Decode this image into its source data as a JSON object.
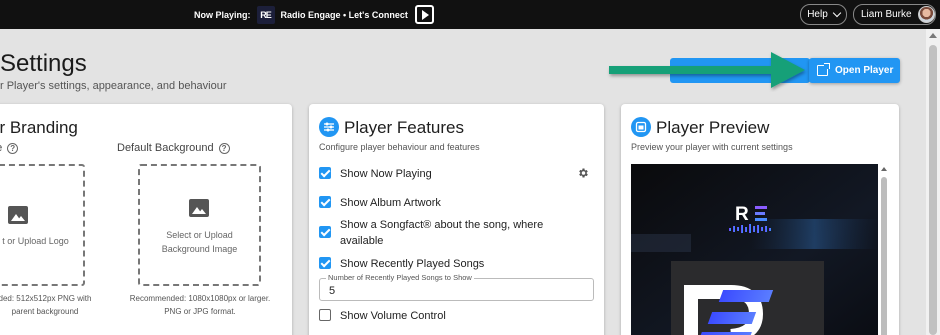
{
  "topbar": {
    "now_playing_label": "Now Playing:",
    "station_logo_text": "RE",
    "station_text": "Radio Engage • Let's Connect",
    "help_label": "Help",
    "user_name": "Liam Burke"
  },
  "header": {
    "title": "Settings",
    "subtitle": "r Player's settings, appearance, and behaviour",
    "open_player_label": "Open Player"
  },
  "branding": {
    "title": "er Branding",
    "logo_label": "de",
    "logo_upload_text": "t or Upload Logo",
    "logo_rec_line1": "ded: 512x512px PNG with",
    "logo_rec_line2": "parent background",
    "bg_label": "Default Background",
    "bg_upload_line1": "Select or Upload",
    "bg_upload_line2": "Background Image",
    "bg_rec_line1": "Recommended: 1080x1080px or larger.",
    "bg_rec_line2": "PNG or JPG format."
  },
  "features": {
    "title": "Player Features",
    "description": "Configure player behaviour and features",
    "items": [
      {
        "label": "Show Now Playing",
        "checked": true
      },
      {
        "label": "Show Album Artwork",
        "checked": true
      },
      {
        "label": "Show a Songfact® about the song, where available",
        "checked": true
      },
      {
        "label": "Show Recently Played Songs",
        "checked": true
      },
      {
        "label": "Show Volume Control",
        "checked": false
      }
    ],
    "recent_count_label": "Number of Recently Played Songs to Show",
    "recent_count_value": "5"
  },
  "preview": {
    "title": "Player Preview",
    "description": "Preview your player with current settings",
    "logo_text": "RE"
  },
  "colors": {
    "accent": "#2196f3",
    "annotation_arrow": "#14a078",
    "topbar": "#111111"
  }
}
